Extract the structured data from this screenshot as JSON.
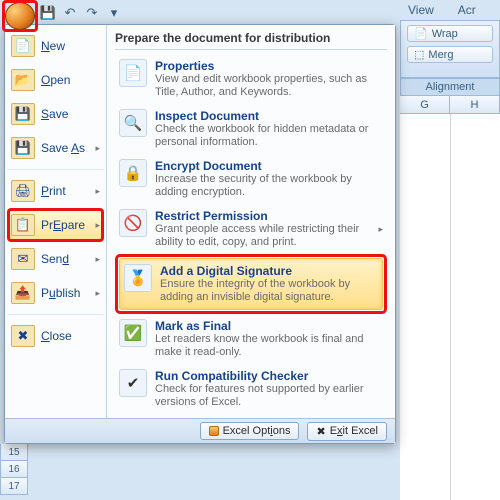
{
  "qat": {
    "save_icon": "💾",
    "undo_icon": "↶",
    "redo_icon": "↷",
    "dd_icon": "▾"
  },
  "ribbon": {
    "tabs": [
      "View",
      "Acr"
    ],
    "wrap_label": "Wrap",
    "merge_label": "Merg",
    "section": "Alignment",
    "columns": [
      "G",
      "H"
    ]
  },
  "rows": [
    "15",
    "16",
    "17"
  ],
  "left_menu": {
    "new": {
      "label": "New",
      "u": "N"
    },
    "open": {
      "label": "Open",
      "u": "O"
    },
    "save": {
      "label": "Save",
      "u": "S"
    },
    "saveas": {
      "label": "Save As",
      "u": "A",
      "has_sub": "▸"
    },
    "print": {
      "label": "Print",
      "u": "P",
      "has_sub": "▸"
    },
    "prepare": {
      "label": "Prepare",
      "u": "E",
      "has_sub": "▸"
    },
    "send": {
      "label": "Send",
      "u": "d",
      "prefix": "Sen",
      "has_sub": "▸"
    },
    "publish": {
      "label": "Publish",
      "u": "u",
      "prefix": "P",
      "suffix": "blish",
      "has_sub": "▸"
    },
    "close": {
      "label": "Close",
      "u": "C"
    }
  },
  "right": {
    "title": "Prepare the document for distribution",
    "properties": {
      "t": "Properties",
      "d": "View and edit workbook properties, such as Title, Author, and Keywords."
    },
    "inspect": {
      "t": "Inspect Document",
      "d": "Check the workbook for hidden metadata or personal information."
    },
    "encrypt": {
      "t": "Encrypt Document",
      "d": "Increase the security of the workbook by adding encryption."
    },
    "restrict": {
      "t": "Restrict Permission",
      "d": "Grant people access while restricting their ability to edit, copy, and print.",
      "has_sub": "▸"
    },
    "signature": {
      "t": "Add a Digital Signature",
      "d": "Ensure the integrity of the workbook by adding an invisible digital signature."
    },
    "final": {
      "t": "Mark as Final",
      "d": "Let readers know the workbook is final and make it read-only."
    },
    "compat": {
      "t": "Run Compatibility Checker",
      "d": "Check for features not supported by earlier versions of Excel."
    }
  },
  "footer": {
    "options": "Excel Options",
    "exit": "Exit Excel",
    "opt_u": "i",
    "opt_pre": "Excel Opt",
    "opt_suf": "ons",
    "exit_u": "x",
    "exit_pre": "E",
    "exit_suf": "it Excel"
  }
}
